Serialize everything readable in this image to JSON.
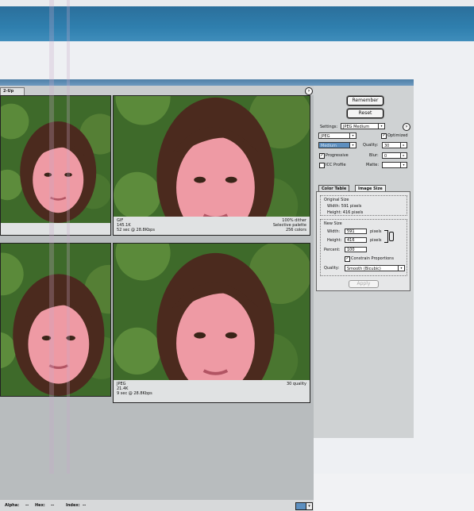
{
  "window": {
    "tab_2up": "2-Up"
  },
  "panes": [
    {
      "id": "top-left"
    },
    {
      "id": "top-right",
      "info_left": [
        "GIF",
        "145.1K",
        "52 sec @ 28.8Kbps"
      ],
      "info_right": [
        "100% dither",
        "Selective palette",
        "256 colors"
      ]
    },
    {
      "id": "bottom-left"
    },
    {
      "id": "bottom-right",
      "info_left": [
        "JPEG",
        "21.4K",
        "9 sec @ 28.8Kbps"
      ],
      "info_right": [
        "30 quality"
      ]
    }
  ],
  "statusbar": {
    "alpha": "Alpha:",
    "alpha_val": "--",
    "hex": "Hex:",
    "hex_val": "--",
    "index": "Index:",
    "index_val": "--"
  },
  "side": {
    "remember": "Remember",
    "reset": "Reset",
    "settings_label": "Settings:",
    "settings_value": "JPEG Medium",
    "format_value": "JPEG",
    "optimized_label": "Optimized",
    "optimized_checked": true,
    "quality_preset": "Medium",
    "quality_label": "Quality:",
    "quality_value": "30",
    "progressive_label": "Progressive",
    "progressive_checked": true,
    "blur_label": "Blur:",
    "blur_value": "0",
    "icc_label": "ICC Profile",
    "icc_checked": false,
    "matte_label": "Matte:",
    "matte_value": ""
  },
  "image_size_panel": {
    "tab_color_table": "Color Table",
    "tab_image_size": "Image Size",
    "original_size": "Original Size",
    "orig_width": "Width: 591 pixels",
    "orig_height": "Height: 416 pixels",
    "new_size": "New Size",
    "width_label": "Width:",
    "width_value": "591",
    "height_label": "Height:",
    "height_value": "416",
    "unit": "pixels",
    "percent_label": "Percent:",
    "percent_value": "100",
    "constrain_label": "Constrain Proportions",
    "constrain_checked": true,
    "quality_label": "Quality:",
    "quality_value": "Smooth (Bicubic)",
    "apply_label": "Apply"
  },
  "colors": {
    "brand_blue": "#2f7fae",
    "hair": "#4b2a1e",
    "skin": "#ee9aa4",
    "foliage": "#3e6a2a"
  }
}
